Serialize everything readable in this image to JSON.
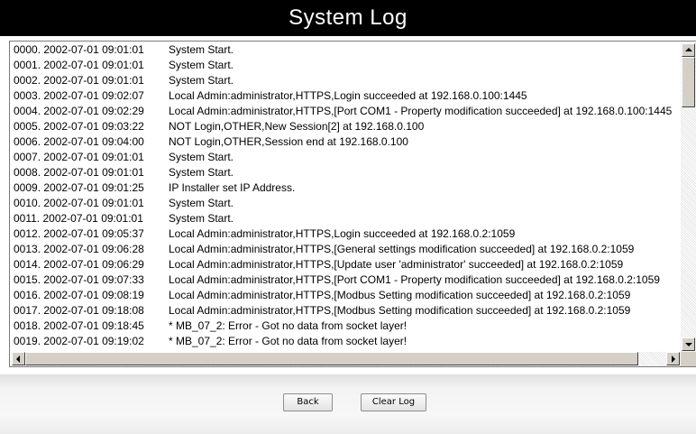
{
  "title": "System Log",
  "log": {
    "entries": [
      {
        "ts": "0000. 2002-07-01 09:01:01",
        "msg": "System Start."
      },
      {
        "ts": "0001. 2002-07-01 09:01:01",
        "msg": "System Start."
      },
      {
        "ts": "0002. 2002-07-01 09:01:01",
        "msg": "System Start."
      },
      {
        "ts": "0003. 2002-07-01 09:02:07",
        "msg": "Local Admin:administrator,HTTPS,Login succeeded at 192.168.0.100:1445"
      },
      {
        "ts": "0004. 2002-07-01 09:02:29",
        "msg": "Local Admin:administrator,HTTPS,[Port COM1 - Property modification succeeded] at 192.168.0.100:1445"
      },
      {
        "ts": "0005. 2002-07-01 09:03:22",
        "msg": "NOT Login,OTHER,New Session[2] at 192.168.0.100"
      },
      {
        "ts": "0006. 2002-07-01 09:04:00",
        "msg": "NOT Login,OTHER,Session end at 192.168.0.100"
      },
      {
        "ts": "0007. 2002-07-01 09:01:01",
        "msg": "System Start."
      },
      {
        "ts": "0008. 2002-07-01 09:01:01",
        "msg": "System Start."
      },
      {
        "ts": "0009. 2002-07-01 09:01:25",
        "msg": "IP Installer set IP Address."
      },
      {
        "ts": "0010. 2002-07-01 09:01:01",
        "msg": "System Start."
      },
      {
        "ts": "0011. 2002-07-01 09:01:01",
        "msg": "System Start."
      },
      {
        "ts": "0012. 2002-07-01 09:05:37",
        "msg": "Local Admin:administrator,HTTPS,Login succeeded at 192.168.0.2:1059"
      },
      {
        "ts": "0013. 2002-07-01 09:06:28",
        "msg": "Local Admin:administrator,HTTPS,[General settings modification succeeded] at 192.168.0.2:1059"
      },
      {
        "ts": "0014. 2002-07-01 09:06:29",
        "msg": "Local Admin:administrator,HTTPS,[Update user 'administrator' succeeded] at 192.168.0.2:1059"
      },
      {
        "ts": "0015. 2002-07-01 09:07:33",
        "msg": "Local Admin:administrator,HTTPS,[Port COM1 - Property modification succeeded] at 192.168.0.2:1059"
      },
      {
        "ts": "0016. 2002-07-01 09:08:19",
        "msg": "Local Admin:administrator,HTTPS,[Modbus Setting modification succeeded] at 192.168.0.2:1059"
      },
      {
        "ts": "0017. 2002-07-01 09:18:08",
        "msg": "Local Admin:administrator,HTTPS,[Modbus Setting modification succeeded] at 192.168.0.2:1059"
      },
      {
        "ts": "0018. 2002-07-01 09:18:45",
        "msg": "* MB_07_2: Error - Got no data from socket layer!"
      },
      {
        "ts": "0019. 2002-07-01 09:19:02",
        "msg": "* MB_07_2: Error - Got no data from socket layer!"
      }
    ]
  },
  "buttons": {
    "back_label": "Back",
    "clear_log_label": "Clear Log"
  },
  "colors": {
    "title_bg": "#000000",
    "title_fg": "#ffffff"
  }
}
